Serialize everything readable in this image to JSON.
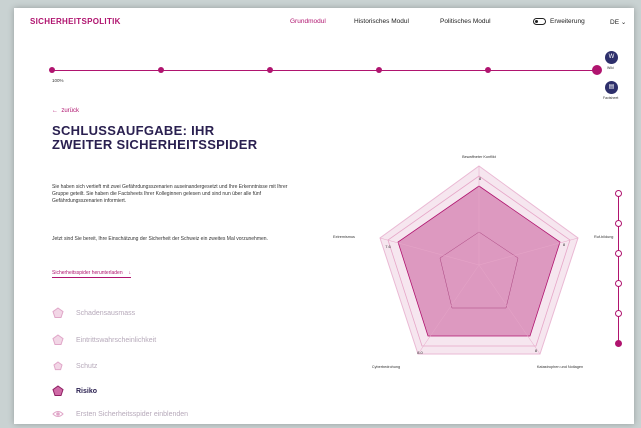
{
  "header": {
    "brand": "SICHERHEITSPOLITIK",
    "nav": [
      "Grundmodul",
      "Historisches Modul",
      "Politisches Modul"
    ],
    "active_nav": "Grundmodul",
    "toggle_label": "Erweiterung",
    "language": "DE"
  },
  "progress": {
    "label": "100%",
    "steps": 6,
    "completed": 6
  },
  "side_buttons": [
    {
      "icon": "W",
      "label": "Wiki"
    },
    {
      "icon": "▤",
      "label": "Factsheet"
    }
  ],
  "back_label": "zurück",
  "title": "SCHLUSSAUFGABE: IHR ZWEITER SICHERHEITSSPIDER",
  "paragraph1": "Sie haben sich vertieft mit zwei Gefährdungsszenarien auseinandergesetzt und Ihre Erkenntnisse mit Ihrer Gruppe geteilt. Sie haben die Factsheets Ihrer Kolleginnen gelesen und sind nun über alle fünf Gefährdungsszenarien informiert.",
  "paragraph2": "Jetzt sind Sie bereit, Ihre Einschätzung der Sicherheit der Schweiz ein zweites Mal vorzunehmen.",
  "download_label": "Sicherheitsspider herunterladen",
  "download_icon": "download-arrow-icon",
  "options": [
    {
      "label": "Schadensausmass",
      "icon": "pentagon-icon",
      "selected": false
    },
    {
      "label": "Eintrittswahrscheinlichkeit",
      "icon": "pentagon-icon",
      "selected": false
    },
    {
      "label": "Schutz",
      "icon": "pentagon-icon",
      "selected": false
    },
    {
      "label": "Risiko",
      "icon": "pentagon-icon",
      "selected": true
    },
    {
      "label": "Ersten Sicherheitsspider einblenden",
      "icon": "eye-icon",
      "selected": false
    }
  ],
  "radar": {
    "axes": [
      "Bewaffneter Konflikt",
      "Ruf-bildung",
      "Katastrophen und Notlagen",
      "Cyberbedrohung",
      "Extremismus"
    ],
    "values": [
      "8",
      "8",
      "8",
      "8.0",
      "7.6"
    ]
  },
  "vertical_steps": 6,
  "colors": {
    "accent": "#b0146f",
    "navy": "#2a2050",
    "radar_fill": "#d47fb0"
  }
}
